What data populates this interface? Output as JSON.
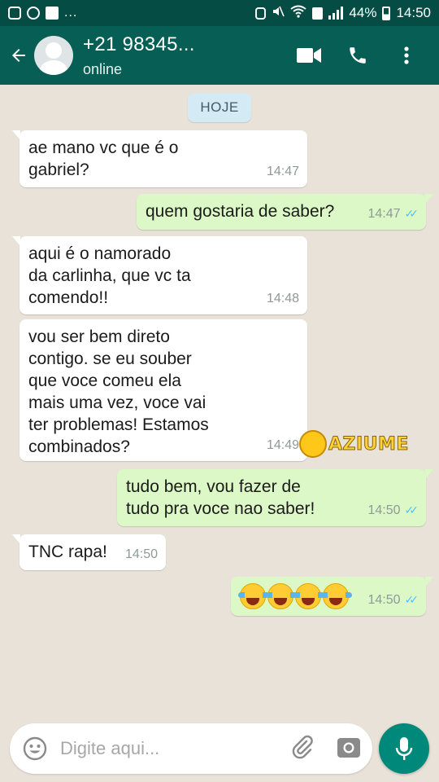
{
  "status_bar": {
    "time": "14:50",
    "battery": "44%",
    "overflow": "...",
    "left_icons": [
      "instagram-icon",
      "whatsapp-icon",
      "facebook-icon"
    ],
    "right_icons": [
      "android-icon",
      "mute-icon",
      "wifi-icon",
      "sim-icon",
      "signal-icon",
      "battery-icon"
    ]
  },
  "header": {
    "contact_name": "+21 98345...",
    "status": "online",
    "icons": [
      "back-arrow-icon",
      "video-call-icon",
      "phone-icon",
      "more-vert-icon"
    ]
  },
  "chat": {
    "date_label": "HOJE",
    "messages": [
      {
        "dir": "in",
        "lines": [
          "ae mano vc que é o",
          "gabriel?"
        ],
        "time": "14:47"
      },
      {
        "dir": "out",
        "lines": [
          "quem gostaria de saber?"
        ],
        "time": "14:47",
        "ticks": "✓✓"
      },
      {
        "dir": "in",
        "lines": [
          "aqui é o namorado",
          "da carlinha, que vc ta",
          "comendo!!"
        ],
        "time": "14:48"
      },
      {
        "dir": "in",
        "lines": [
          "vou ser bem direto",
          "contigo. se eu souber",
          "que voce comeu ela",
          "mais uma vez, voce vai",
          "ter problemas! Estamos",
          "combinados?"
        ],
        "time": "14:49"
      },
      {
        "dir": "out",
        "lines": [
          "tudo bem, vou fazer de",
          "tudo pra voce nao saber!"
        ],
        "time": "14:50",
        "ticks": "✓✓"
      },
      {
        "dir": "in",
        "lines": [
          "TNC rapa!"
        ],
        "time": "14:50"
      },
      {
        "dir": "out",
        "emoji": "😂😂😂😂",
        "time": "14:50",
        "ticks": "✓✓"
      }
    ]
  },
  "watermark": {
    "text": "AZIUME"
  },
  "composer": {
    "placeholder": "Digite aqui...",
    "icons": [
      "emoji-icon",
      "attach-icon",
      "camera-icon",
      "mic-icon"
    ]
  },
  "colors": {
    "header": "#075e54",
    "status_bar": "#054d44",
    "bubble_out": "#dcf8c6",
    "bubble_in": "#ffffff",
    "background": "#e9e2d8",
    "accent": "#00897b",
    "read_ticks": "#4fc3f7"
  }
}
